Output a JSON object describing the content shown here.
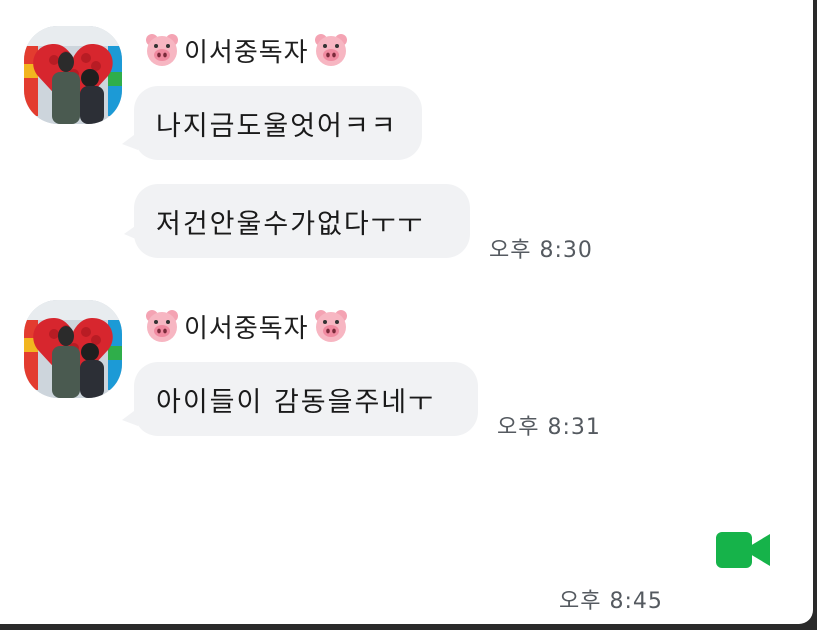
{
  "chat": {
    "colors": {
      "background": "#ffffff",
      "bubble": "#f1f2f4",
      "video_call_green": "#16b34a"
    },
    "groups": [
      {
        "sender": {
          "prefix_icon": "pig-face-icon",
          "name": "이서중독자",
          "suffix_icon": "pig-face-icon"
        },
        "messages": [
          {
            "text": "나지금도울엇어ㅋㅋ"
          },
          {
            "text": "저건안울수가없다ㅜㅜ",
            "time": "오후 8:30"
          }
        ]
      },
      {
        "sender": {
          "prefix_icon": "pig-face-icon",
          "name": "이서중독자",
          "suffix_icon": "pig-face-icon"
        },
        "messages": [
          {
            "text": "아이들이 감동을주네ㅜ",
            "time": "오후 8:31"
          }
        ]
      }
    ],
    "outgoing": {
      "icon": "video-call-icon",
      "time": "오후 8:45"
    }
  }
}
